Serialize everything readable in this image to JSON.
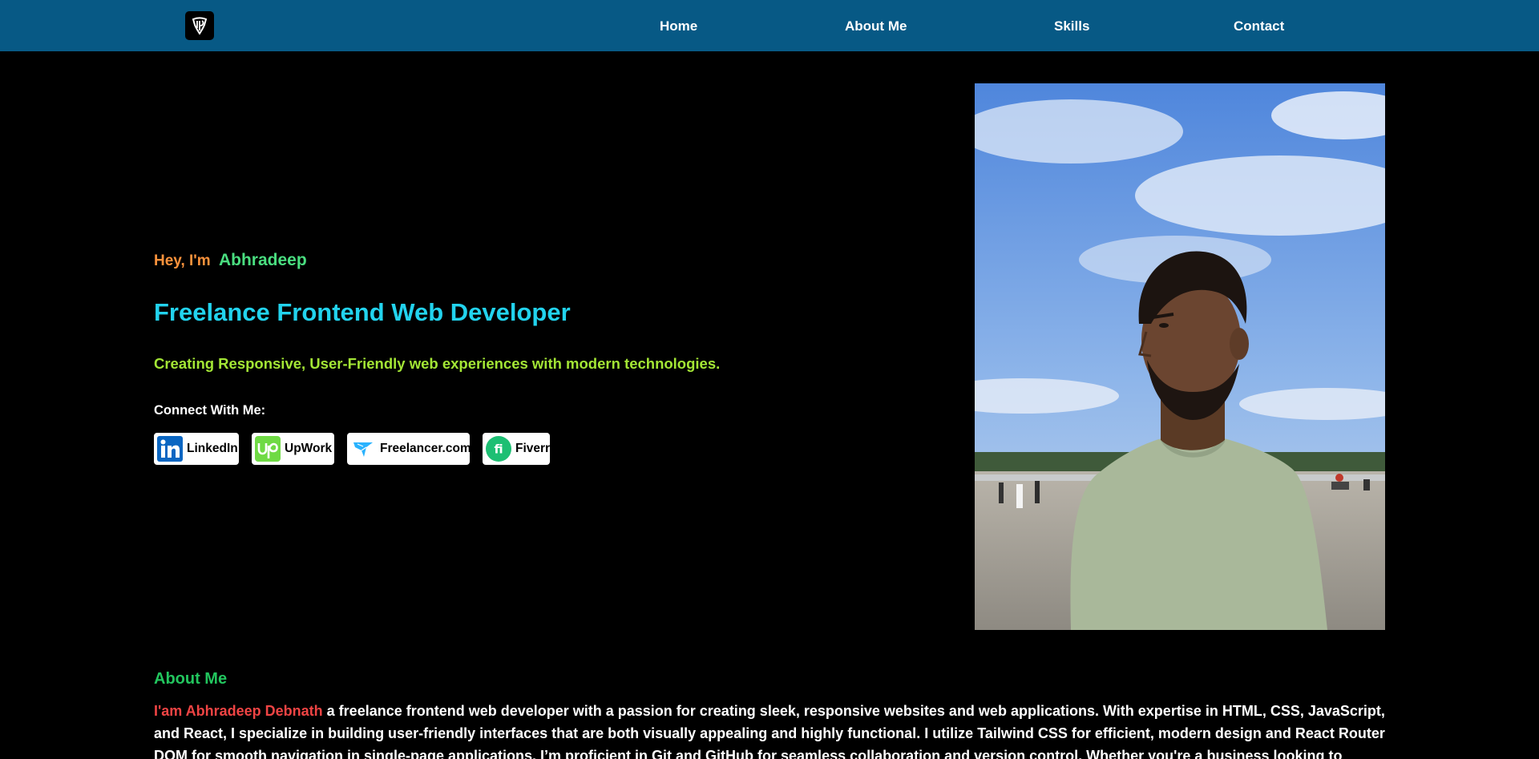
{
  "nav": {
    "links": [
      "Home",
      "About Me",
      "Skills",
      "Contact"
    ],
    "background": "#075985"
  },
  "hero": {
    "greeting": "Hey, I'm",
    "name": "Abhradeep",
    "role": "Freelance Frontend Web Developer",
    "tagline": "Creating Responsive, User-Friendly web experiences with modern technologies.",
    "connect_label": "Connect With Me:",
    "socials": [
      {
        "label": "LinkedIn",
        "icon": "linkedin-icon"
      },
      {
        "label": "UpWork",
        "icon": "upwork-icon"
      },
      {
        "label": "Freelancer.com",
        "icon": "freelancer-icon"
      },
      {
        "label": "Fiverr",
        "icon": "fiverr-icon"
      }
    ]
  },
  "about": {
    "title": "About Me",
    "highlight": "I'am Abhradeep Debnath",
    "text": "a freelance frontend web developer with a passion for creating sleek, responsive websites and web applications. With expertise in HTML, CSS, JavaScript, and React, I specialize in building user-friendly interfaces that are both visually appealing and highly functional. I utilize Tailwind CSS for efficient, modern design and React Router DOM for smooth navigation in single-page applications. I’m proficient in Git and GitHub for seamless collaboration and version control. Whether you're a business looking to establish an online"
  },
  "colors": {
    "greeting": "#fb923c",
    "name": "#4ade80",
    "role": "#22d3ee",
    "tagline": "#a3e635",
    "about_title": "#22c55e",
    "about_highlight": "#ef4444"
  }
}
